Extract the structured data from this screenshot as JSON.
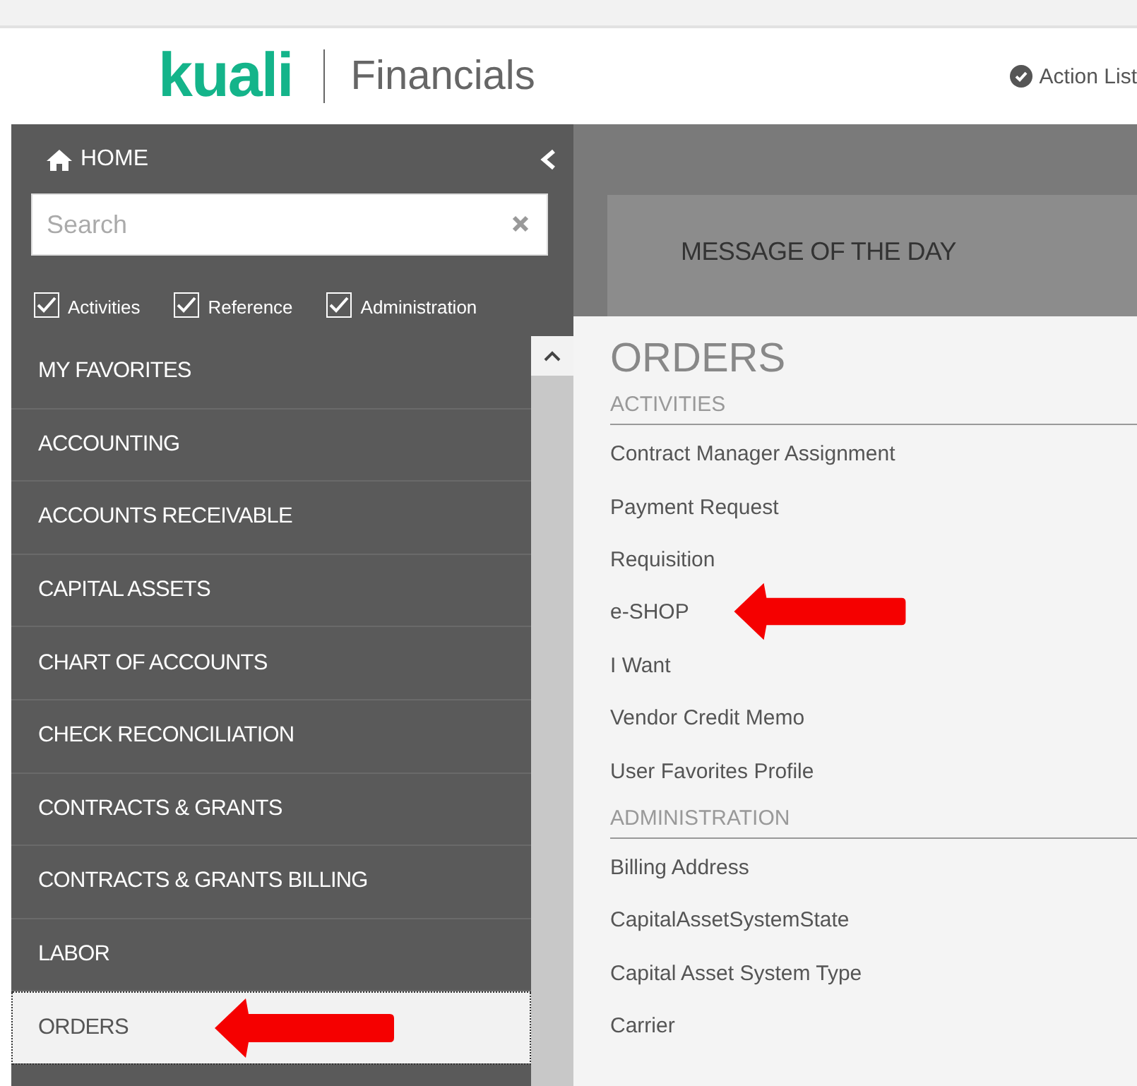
{
  "header": {
    "logo": "kuali",
    "product": "Financials",
    "action_list": "Action List"
  },
  "sidebar": {
    "home": "HOME",
    "search": {
      "placeholder": "Search"
    },
    "filters": [
      {
        "label": "Activities",
        "checked": true
      },
      {
        "label": "Reference",
        "checked": true
      },
      {
        "label": "Administration",
        "checked": true
      }
    ],
    "items": [
      {
        "label": "MY FAVORITES",
        "selected": false,
        "annotated": false
      },
      {
        "label": "ACCOUNTING",
        "selected": false,
        "annotated": false
      },
      {
        "label": "ACCOUNTS RECEIVABLE",
        "selected": false,
        "annotated": false
      },
      {
        "label": "CAPITAL ASSETS",
        "selected": false,
        "annotated": false
      },
      {
        "label": "CHART OF ACCOUNTS",
        "selected": false,
        "annotated": false
      },
      {
        "label": "CHECK RECONCILIATION",
        "selected": false,
        "annotated": false
      },
      {
        "label": "CONTRACTS & GRANTS",
        "selected": false,
        "annotated": false
      },
      {
        "label": "CONTRACTS & GRANTS BILLING",
        "selected": false,
        "annotated": false
      },
      {
        "label": "LABOR",
        "selected": false,
        "annotated": false
      },
      {
        "label": "ORDERS",
        "selected": true,
        "annotated": true
      }
    ]
  },
  "main": {
    "message_title": "MESSAGE OF THE DAY"
  },
  "flyout": {
    "title": "ORDERS",
    "sections": [
      {
        "heading": "ACTIVITIES",
        "items": [
          {
            "label": "Contract Manager Assignment",
            "annotated": false
          },
          {
            "label": "Payment Request",
            "annotated": false
          },
          {
            "label": "Requisition",
            "annotated": false
          },
          {
            "label": "e-SHOP",
            "annotated": true
          },
          {
            "label": "I Want",
            "annotated": false
          },
          {
            "label": "Vendor Credit Memo",
            "annotated": false
          },
          {
            "label": "User Favorites Profile",
            "annotated": false
          }
        ]
      },
      {
        "heading": "ADMINISTRATION",
        "items": [
          {
            "label": "Billing Address",
            "annotated": false
          },
          {
            "label": "CapitalAssetSystemState",
            "annotated": false
          },
          {
            "label": "Capital Asset System Type",
            "annotated": false
          },
          {
            "label": "Carrier",
            "annotated": false
          }
        ]
      }
    ]
  }
}
